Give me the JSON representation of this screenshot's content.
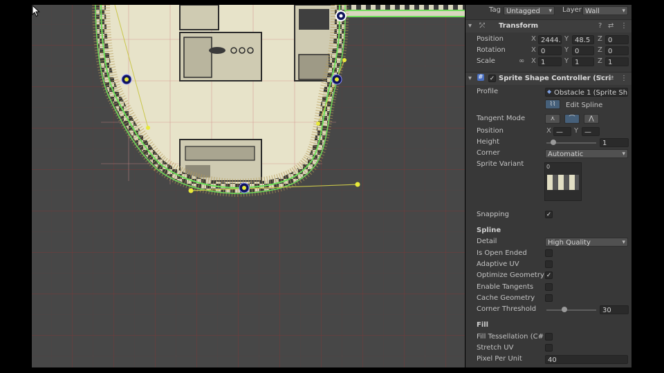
{
  "inspector": {
    "tag_label": "Tag",
    "tag_value": "Untagged",
    "layer_label": "Layer",
    "layer_value": "Wall",
    "transform": {
      "title": "Transform",
      "position_label": "Position",
      "rotation_label": "Rotation",
      "scale_label": "Scale",
      "axes": [
        "X",
        "Y",
        "Z"
      ],
      "position": [
        "2444.",
        "48.5",
        "0"
      ],
      "rotation": [
        "0",
        "0",
        "0"
      ],
      "scale": [
        "1",
        "1",
        "1"
      ]
    },
    "sprite_shape": {
      "title": "Sprite Shape Controller (Scri",
      "profile_label": "Profile",
      "profile_value": "Obstacle 1 (Sprite Sh",
      "edit_spline_label": "Edit Spline",
      "tangent_mode_label": "Tangent Mode",
      "point_position_label": "Position",
      "point_x": "X",
      "point_y": "Y",
      "point_x_value": "—",
      "point_y_value": "—",
      "height_label": "Height",
      "height_value": "1",
      "height_level": 0.1,
      "corner_label": "Corner",
      "corner_value": "Automatic",
      "sprite_variant_label": "Sprite Variant",
      "sprite_variant_index": "0",
      "snapping_label": "Snapping",
      "snapping_checked": true,
      "spline_section": "Spline",
      "detail_label": "Detail",
      "detail_value": "High Quality",
      "is_open_ended_label": "Is Open Ended",
      "is_open_ended": false,
      "adaptive_uv_label": "Adaptive UV",
      "adaptive_uv": false,
      "optimize_geometry_label": "Optimize Geometry",
      "optimize_geometry": true,
      "enable_tangents_label": "Enable Tangents",
      "enable_tangents": false,
      "cache_geometry_label": "Cache Geometry",
      "cache_geometry": false,
      "corner_threshold_label": "Corner Threshold",
      "corner_threshold_value": "30",
      "corner_threshold_level": 0.35,
      "fill_section": "Fill",
      "fill_tessellation_label": "Fill Tessellation (C# J",
      "fill_tessellation": false,
      "stretch_uv_label": "Stretch UV",
      "stretch_uv": false,
      "pixel_per_unit_label": "Pixel Per Unit",
      "pixel_per_unit_value": "40"
    }
  },
  "icons": {
    "checkmark": "✓",
    "help": "?",
    "settings": "⇄",
    "more": "⋮",
    "link": "∞"
  },
  "colors": {
    "spline": "#6ede5a",
    "handle": "#e8ea3a",
    "control_point": "#10145a",
    "grid": "#8a3434"
  }
}
